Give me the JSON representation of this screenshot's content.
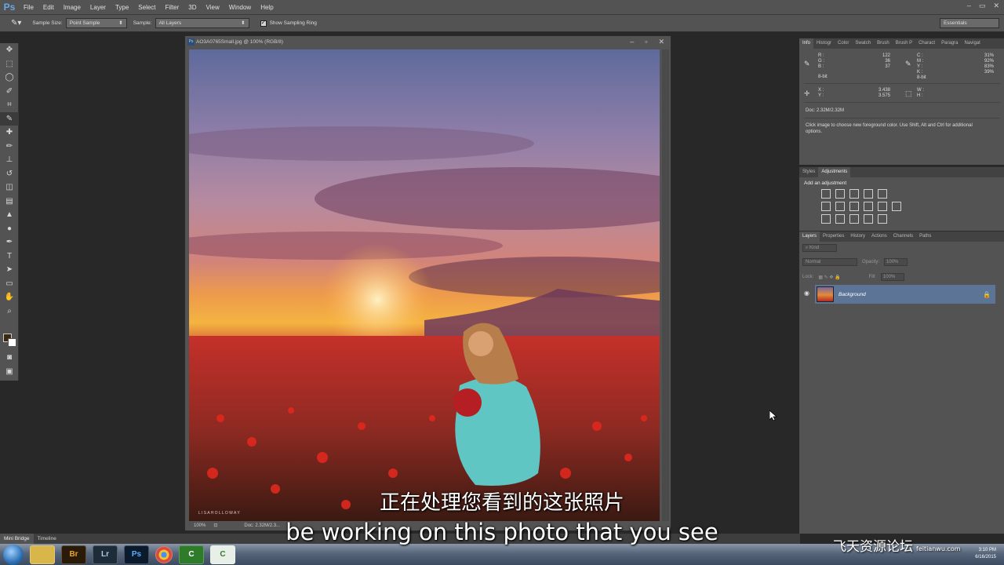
{
  "app": {
    "logo": "Ps"
  },
  "menu": [
    "File",
    "Edit",
    "Image",
    "Layer",
    "Type",
    "Select",
    "Filter",
    "3D",
    "View",
    "Window",
    "Help"
  ],
  "window_controls": [
    "–",
    "▭",
    "✕"
  ],
  "options_bar": {
    "sample_size_label": "Sample Size:",
    "sample_size_value": "Point Sample",
    "sample_label": "Sample:",
    "sample_value": "All Layers",
    "show_sampling_ring": "Show Sampling Ring",
    "workspace": "Essentials"
  },
  "document": {
    "title": "AO3A0765Small.jpg @ 100% (RGB/8)",
    "zoom": "100%",
    "doc_size": "Doc: 2.32M/2.3...",
    "photographer_mark": "L I S A   H O L L O W A Y"
  },
  "info_panel": {
    "tabs": [
      "Info",
      "Histogr",
      "Color",
      "Swatch",
      "Brush",
      "Brush P",
      "Charact",
      "Paragra",
      "Navigat"
    ],
    "rgb": {
      "R": "122",
      "G": "36",
      "B": "37"
    },
    "cmyk": {
      "C": "31%",
      "M": "92%",
      "Y": "83%",
      "K": "39%"
    },
    "bit_left": "8-bit",
    "bit_right": "8-bit",
    "x": "3.438",
    "y": "3.575",
    "w_label": "W :",
    "h_label": "H :",
    "doc": "Doc: 2.32M/2.32M",
    "hint": "Click image to choose new foreground color. Use Shift, Alt and Ctrl for additional options."
  },
  "adjustments_panel": {
    "tabs": [
      "Styles",
      "Adjustments"
    ],
    "heading": "Add an adjustment"
  },
  "layers_panel": {
    "tabs": [
      "Layers",
      "Properties",
      "History",
      "Actions",
      "Channels",
      "Paths"
    ],
    "kind": "Kind",
    "blend_mode": "Normal",
    "opacity_label": "Opacity:",
    "opacity_value": "100%",
    "lock_label": "Lock:",
    "fill_label": "Fill:",
    "fill_value": "100%",
    "layer_name": "Background"
  },
  "bottom_tabs": [
    "Mini Bridge",
    "Timeline"
  ],
  "taskbar": {
    "apps": [
      {
        "name": "folder",
        "label": ""
      },
      {
        "name": "bridge",
        "label": "Br"
      },
      {
        "name": "lightroom",
        "label": "Lr"
      },
      {
        "name": "photoshop",
        "label": "Ps"
      },
      {
        "name": "chrome",
        "label": ""
      },
      {
        "name": "camtasia-1",
        "label": "C"
      },
      {
        "name": "camtasia-2",
        "label": "C"
      }
    ],
    "time": "3:10 PM",
    "date": "6/16/2015"
  },
  "subtitles": {
    "zh": "正在处理您看到的这张照片",
    "en": "be working on this photo that you see"
  },
  "watermark": {
    "text": "飞天资源论坛",
    "url": "feitianwu.com"
  },
  "colors": {
    "panel_bg": "#535353",
    "workspace_bg": "#282828",
    "layer_selected": "#5c7597"
  }
}
